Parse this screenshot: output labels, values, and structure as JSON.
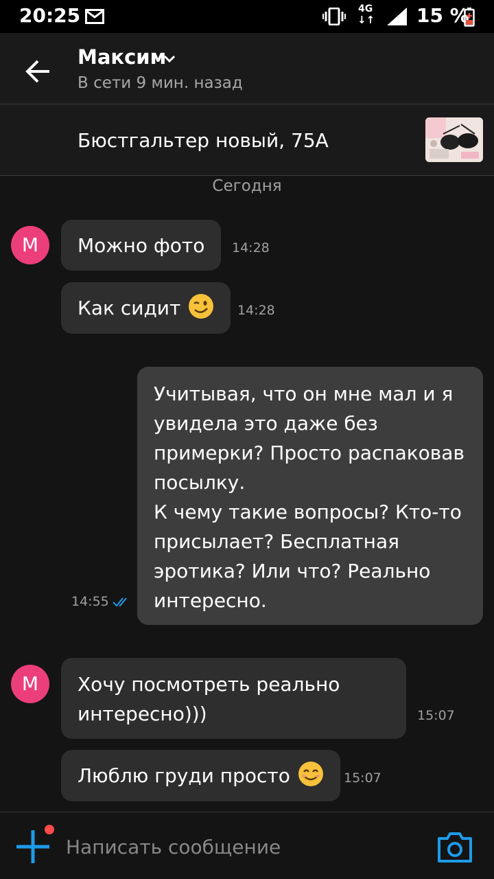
{
  "status_bar": {
    "time": "20:25",
    "network": "4G",
    "network_arrows": "↓↑",
    "battery": "15 %",
    "icons": [
      "mail-icon",
      "vibrate-icon",
      "signal-icon",
      "battery-icon"
    ]
  },
  "header": {
    "contact_name": "Максим",
    "status": "В сети 9 мин. назад",
    "icons": [
      "back-arrow-icon",
      "chevron-down-icon"
    ]
  },
  "listing": {
    "title": "Бюстгальтер новый, 75А"
  },
  "date_divider": "Сегодня",
  "avatar_letter": "M",
  "messages": [
    {
      "direction": "in",
      "text": "Можно фото",
      "time": "14:28"
    },
    {
      "direction": "in",
      "text": "Как сидит",
      "emoji": "winking-face-emoji",
      "time": "14:28"
    },
    {
      "direction": "out",
      "text": "Учитывая, что он мне мал и я увидела это даже без примерки? Просто распаковав посылку.\nК чему такие вопросы? Кто-то присылает? Бесплатная эротика? Или что? Реально интересно.",
      "time": "14:55",
      "read": true
    },
    {
      "direction": "in",
      "text": "Хочу посмотреть реально интересно)))",
      "time": "15:07"
    },
    {
      "direction": "in",
      "text": "Люблю груди просто",
      "emoji": "smiling-face-emoji",
      "time": "15:07"
    }
  ],
  "out_lines": [
    "Учитывая, что он мне мал и я",
    "увидела это даже без",
    "примерки? Просто распаковав",
    "посылку.",
    "К чему такие вопросы? Кто-то",
    "присылает? Бесплатная",
    "эротика? Или что? Реально",
    "интересно."
  ],
  "in_lines_4": [
    "Хочу посмотреть реально",
    "интересно)))"
  ],
  "composer": {
    "placeholder": "Написать сообщение",
    "icons": [
      "plus-icon",
      "camera-icon"
    ]
  },
  "colors": {
    "background": "#141414",
    "incoming_bubble": "#2e2e2e",
    "outgoing_bubble": "#3d3d3d",
    "accent": "#1e9be9",
    "avatar": "#ec3e7a",
    "notification": "#ff4b4b"
  }
}
